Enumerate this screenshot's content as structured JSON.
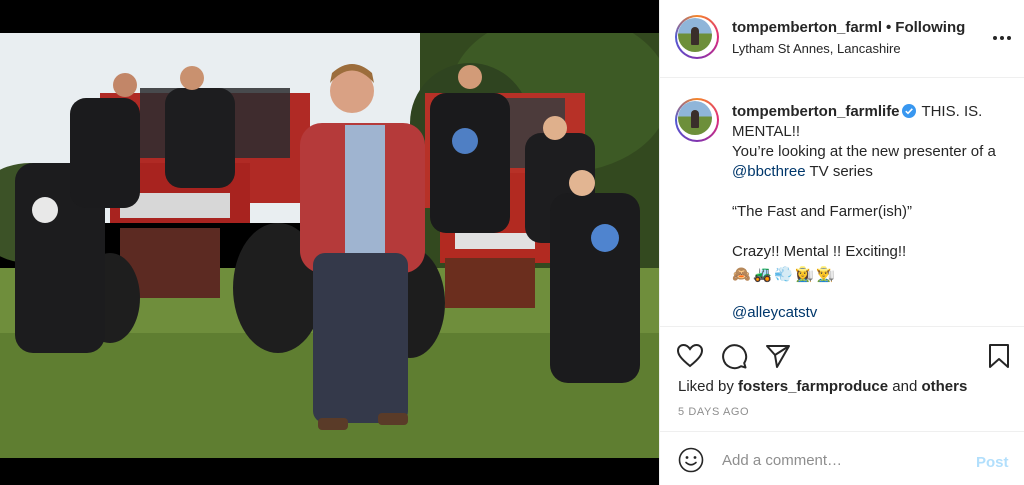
{
  "post": {
    "username": "tompemberton_farml",
    "separator": "•",
    "follow_status": "Following",
    "location": "Lytham St Annes, Lancashire"
  },
  "caption": {
    "username": "tompemberton_farmlife",
    "line1": "THIS. IS. MENTAL!!",
    "line2_pre": "You’re looking at the new presenter of a ",
    "mention1": "@bbcthree",
    "line2_post": " TV series",
    "line3": "“The Fast and Farmer(ish)”",
    "line4": "Crazy!! Mental !! Exciting!!",
    "emojis": [
      "🙈",
      "🚜",
      "💨",
      "👩‍🌾",
      "👨‍🌾"
    ],
    "mention2": "@alleycatstv"
  },
  "engagement": {
    "liked_prefix": "Liked by ",
    "liked_user": "fosters_farmproduce",
    "liked_mid": " and ",
    "liked_others": "others",
    "time_ago": "5 DAYS AGO"
  },
  "comment": {
    "placeholder": "Add a comment…",
    "post_label": "Post"
  },
  "colors": {
    "verified": "#3897f0",
    "link": "#00376b",
    "post_disabled": "#b2dffc",
    "muted": "#8e8e8e"
  }
}
